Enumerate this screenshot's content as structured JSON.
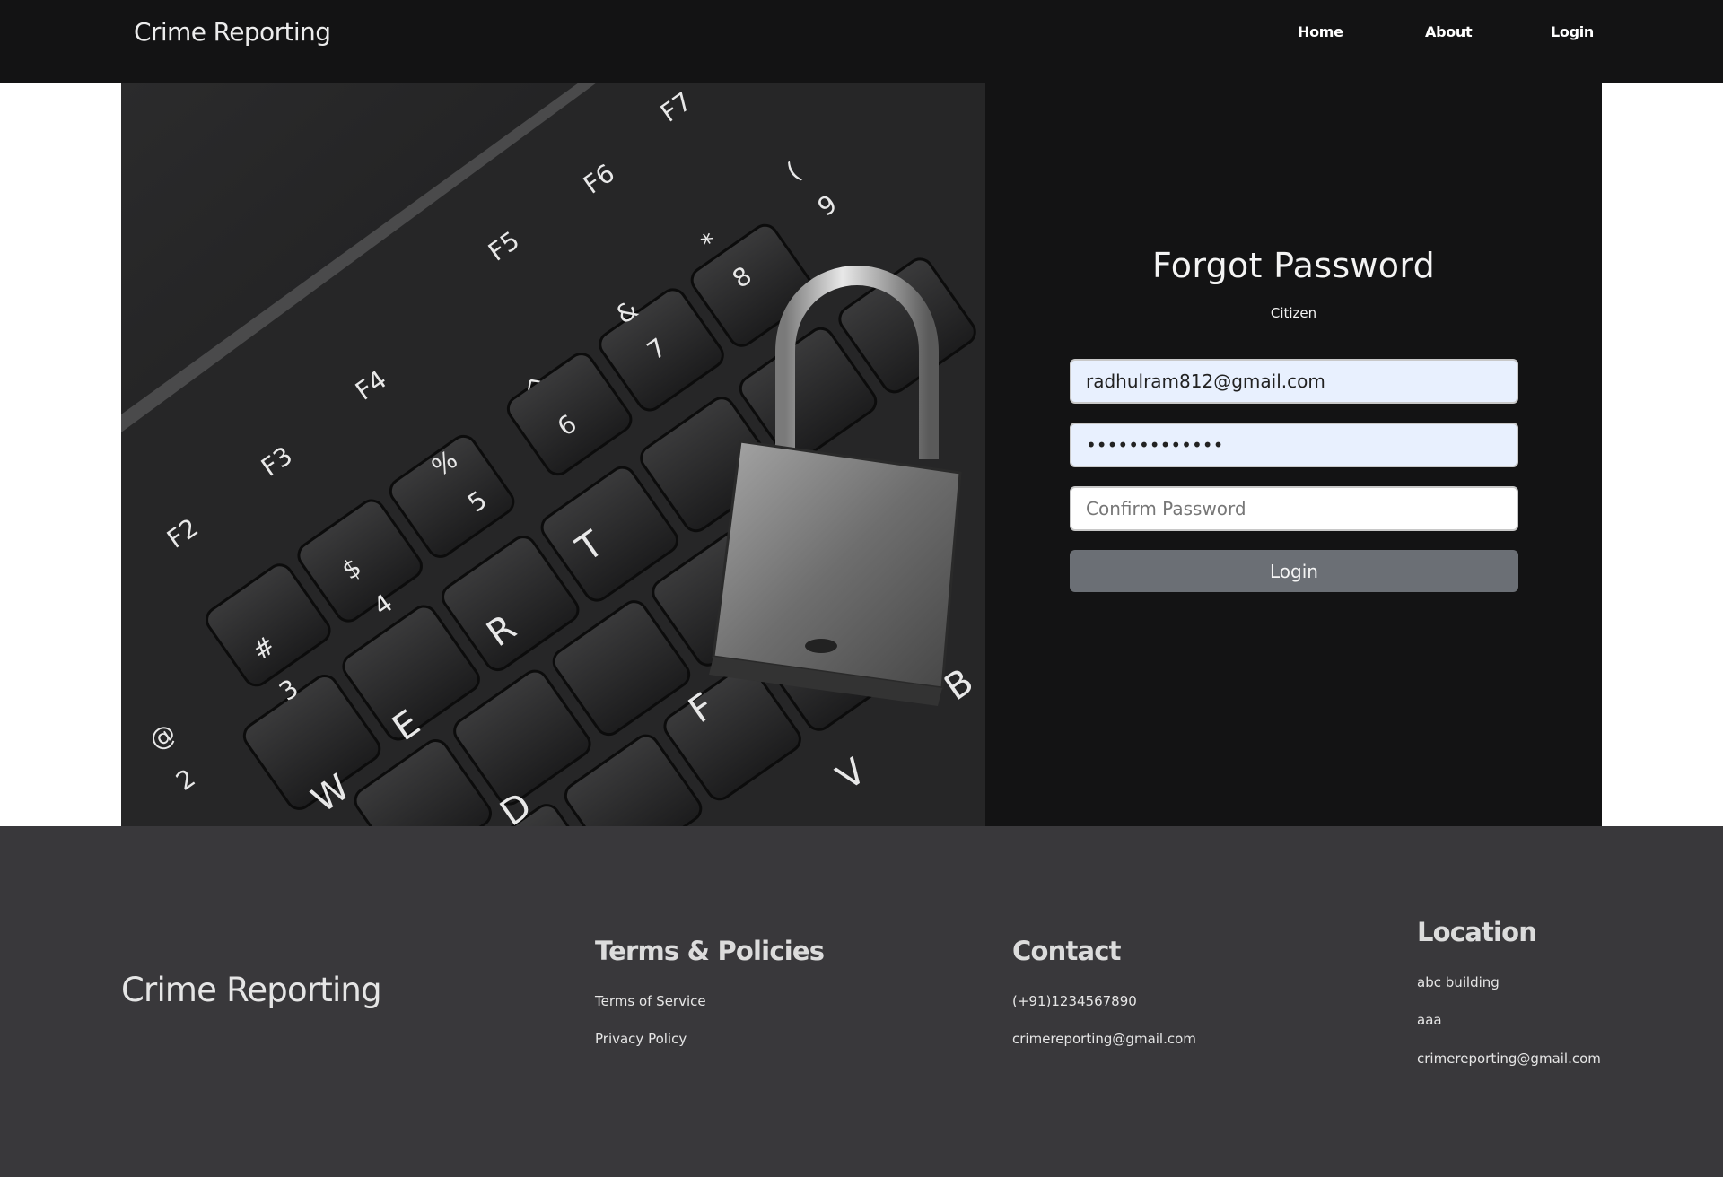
{
  "navbar": {
    "brand": "Crime Reporting",
    "links": [
      "Home",
      "About",
      "Login"
    ]
  },
  "hero": {
    "image_alt": "keyboard-with-padlock",
    "key_labels": [
      "F2",
      "F3",
      "F4",
      "F5",
      "F6",
      "F7",
      "@ 2",
      "# 3",
      "$ 4",
      "% 5",
      "^ 6",
      "& 7",
      "* 8",
      "( 9",
      "W",
      "E",
      "R",
      "T",
      "D",
      "F",
      "V",
      "B"
    ]
  },
  "form": {
    "title": "Forgot Password",
    "subtitle": "Citizen",
    "email_value": "radhulram812@gmail.com",
    "password_value": "•••••••••••••",
    "confirm_placeholder": "Confirm Password",
    "submit_label": "Login"
  },
  "footer": {
    "brand": "Crime Reporting",
    "terms": {
      "title": "Terms & Policies",
      "items": [
        "Terms of Service",
        "Privacy Policy"
      ]
    },
    "contact": {
      "title": "Contact",
      "phone": "(+91)1234567890",
      "email": "crimereporting@gmail.com"
    },
    "location": {
      "title": "Location",
      "line1": "abc building",
      "line2": "aaa",
      "email": "crimereporting@gmail.com"
    }
  },
  "colors": {
    "navbar_bg": "#131314",
    "footer_bg": "#39383b",
    "button_bg": "#6b6f75",
    "autofill_bg": "#e8f0fe"
  }
}
